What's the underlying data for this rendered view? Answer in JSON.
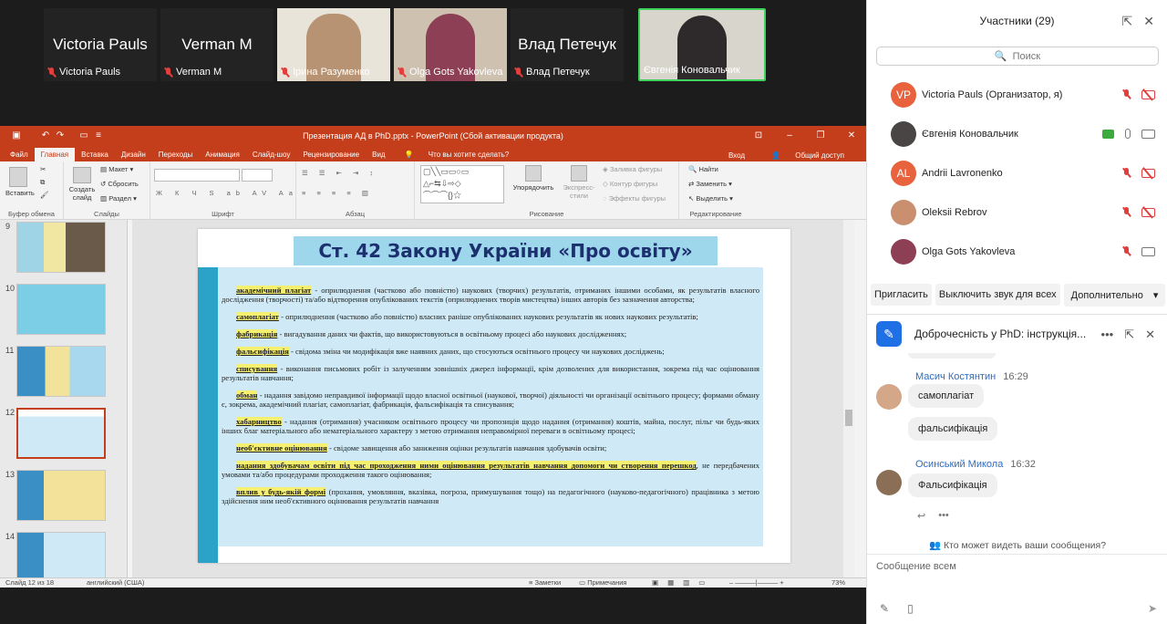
{
  "video": {
    "tiles": [
      {
        "big_name": "Victoria Pauls",
        "caption": "Victoria Pauls",
        "type": "name"
      },
      {
        "big_name": "Verman M",
        "caption": "Verman M",
        "type": "name"
      },
      {
        "caption": "Ірина Разуменко",
        "type": "photo",
        "color": "#b79373"
      },
      {
        "caption": "Olga Gots Yakovleva",
        "type": "photo",
        "color": "#8d3f56"
      },
      {
        "big_name": "Влад Петечук",
        "caption": "Влад Петечук",
        "type": "name"
      },
      {
        "caption": "Євгенія Коновальчик",
        "type": "photo",
        "color": "#2e2a2b",
        "active": true
      }
    ]
  },
  "ppt": {
    "window_title": "Презентация АД в PhD.pptx - PowerPoint (Сбой активации продукта)",
    "tabs": [
      "Файл",
      "Главная",
      "Вставка",
      "Дизайн",
      "Переходы",
      "Анимация",
      "Слайд-шоу",
      "Рецензирование",
      "Вид",
      "Что вы хотите сделать?"
    ],
    "right_tabs": [
      "Вход",
      "Общий доступ"
    ],
    "ribbon": {
      "paste": "Вставить",
      "clipboard": "Буфер обмена",
      "create_slide": "Создать слайд",
      "layout": "Макет",
      "reset": "Сбросить",
      "section": "Раздел",
      "slides": "Слайды",
      "font": "Шрифт",
      "paragraph": "Абзац",
      "arrange": "Упорядочить",
      "quick_styles": "Экспресс-стили",
      "fill": "Заливка фигуры",
      "outline": "Контур фигуры",
      "effects": "Эффекты фигуры",
      "drawing": "Рисование",
      "find": "Найти",
      "replace": "Заменить",
      "select": "Выделить",
      "editing": "Редактирование"
    },
    "thumbs": [
      "9",
      "10",
      "11",
      "12",
      "13",
      "14"
    ],
    "selected_thumb": "12",
    "slide": {
      "title": "Ст. 42 Закону України «Про освіту»",
      "items": [
        {
          "term": "академічний плагіат",
          "text": " - оприлюднення (частково або повністю) наукових (творчих) результатів, отриманих іншими особами, як результатів власного дослідження (творчості) та/або відтворення опублікованих текстів (оприлюднених творів мистецтва) інших авторів без зазначення авторства;"
        },
        {
          "term": "самоплагіат",
          "text": " - оприлюднення (частково або повністю) власних раніше опублікованих наукових результатів як нових наукових результатів;"
        },
        {
          "term": "фабрикація",
          "text": " - вигадування даних чи фактів, що використовуються в освітньому процесі або наукових дослідженнях;"
        },
        {
          "term": "фальсифікація",
          "text": " - свідома зміна чи модифікація вже наявних даних, що стосуються освітнього процесу чи наукових досліджень;"
        },
        {
          "term": "списування",
          "text": " - виконання письмових робіт із залученням зовнішніх джерел інформації, крім дозволених для використання, зокрема під час оцінювання результатів навчання;"
        },
        {
          "term": "обман",
          "text": " - надання завідомо неправдивої інформації щодо власної освітньої (наукової, творчої) діяльності чи організації освітнього процесу; формами обману є, зокрема, академічний плагіат, самоплагіат, фабрикація, фальсифікація та списування;"
        },
        {
          "term": "хабарництво",
          "text": " - надання (отримання) учасником освітнього процесу чи пропозиція щодо надання (отримання) коштів, майна, послуг, пільг чи будь-яких інших благ матеріального або нематеріального характеру з метою отримання неправомірної переваги в освітньому процесі;"
        },
        {
          "term": "необ'єктивне оцінювання",
          "text": " - свідоме завищення або заниження оцінки результатів навчання здобувачів освіти;"
        },
        {
          "term": "надання здобувачам освіти під час проходження ними оцінювання результатів навчання допомоги чи створення перешкод",
          "text": ", не передбачених умовами та/або процедурами проходження такого оцінювання;"
        },
        {
          "term": "вплив у будь-якій формі",
          "text": " (прохання, умовляння, вказівка, погроза, примушування тощо) на педагогічного (науково-педагогічного) працівника з метою здійснення ним необ'єктивного оцінювання результатів навчання"
        }
      ]
    },
    "status": {
      "slide_of": "Слайд 12 из 18",
      "language": "английский (США)",
      "notes": "Заметки",
      "comments": "Примечания",
      "zoom": "73%"
    }
  },
  "participants": {
    "title": "Участники (29)",
    "search_placeholder": "Поиск",
    "list": [
      {
        "name": "Victoria Pauls (Организатор, я)",
        "initials": "VP",
        "color": "#e8623d",
        "mic": "off",
        "cam": "off"
      },
      {
        "name": "Євгенія Коновальчик",
        "initials": "",
        "color": "#4a4545",
        "mic": "on",
        "cam": "on",
        "share": true
      },
      {
        "name": "Andrii Lavronenko",
        "initials": "AL",
        "color": "#e8623d",
        "mic": "off",
        "cam": "off"
      },
      {
        "name": "Oleksii Rebrov",
        "initials": "",
        "color": "#c98f6f",
        "mic": "off",
        "cam": "off"
      },
      {
        "name": "Olga Gots Yakovleva",
        "initials": "",
        "color": "#8d3f56",
        "mic": "off",
        "cam": "on"
      }
    ],
    "invite": "Пригласить",
    "mute_all": "Выключить звук для всех",
    "more": "Дополнительно"
  },
  "chat": {
    "title": "Доброчесність у PhD: інструкція...",
    "messages": [
      {
        "sender": "Масич Костянтин",
        "time": "16:29",
        "bubbles": [
          "самоплагіат",
          "фальсифікація"
        ]
      },
      {
        "sender": "Осинський Микола",
        "time": "16:32",
        "bubbles": [
          "Фальсифікація"
        ]
      }
    ],
    "who_can_see": "Кто может видеть ваши сообщения?",
    "input_placeholder": "Сообщение всем"
  }
}
